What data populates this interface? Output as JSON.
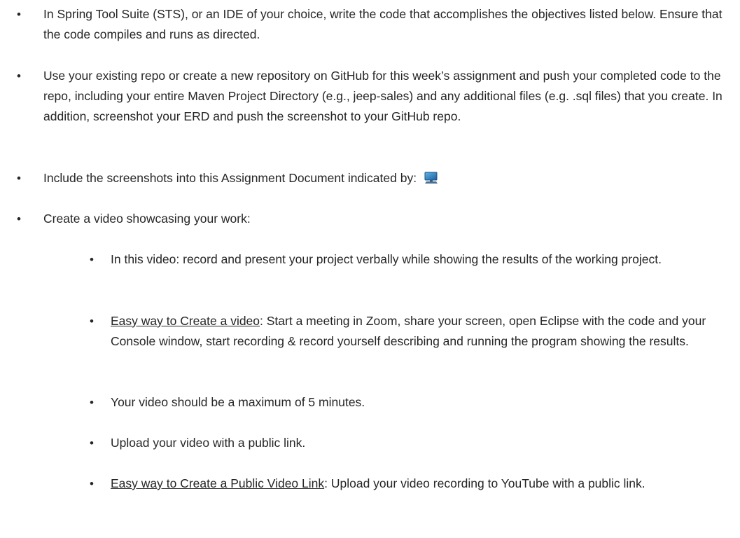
{
  "bullet_char": "•",
  "items": [
    {
      "level": 1,
      "text": "In Spring Tool Suite (STS), or an IDE of your choice, write the code that accomplishes the objectives listed below. Ensure that the code compiles and runs as directed."
    },
    {
      "level": 1,
      "text": "Use your existing repo or create a new repository on GitHub for this week’s assignment and push your completed code to the repo, including your entire Maven Project Directory (e.g., jeep-sales) and any additional files (e.g. .sql files) that you create.  In addition, screenshot your ERD and push the screenshot to your GitHub repo."
    },
    {
      "level": 1,
      "text": "Include the screenshots into this Assignment Document indicated by:",
      "icon": "monitor-icon"
    },
    {
      "level": 1,
      "text": "Create a video showcasing your work:"
    },
    {
      "level": 2,
      "text": "In this video: record and present your project verbally while showing the results of the working project."
    },
    {
      "level": 2,
      "underlined": "Easy way to Create a video",
      "text": ":  Start a meeting in Zoom, share your screen, open Eclipse with the code and your Console window, start recording & record yourself describing and running the program showing the results."
    },
    {
      "level": 2,
      "text": "Your video should be a maximum of 5 minutes."
    },
    {
      "level": 2,
      "text": "Upload your video with a public link."
    },
    {
      "level": 2,
      "underlined": "Easy way to Create a Public Video Link",
      "text": ":  Upload your video recording to YouTube with a public link."
    }
  ]
}
